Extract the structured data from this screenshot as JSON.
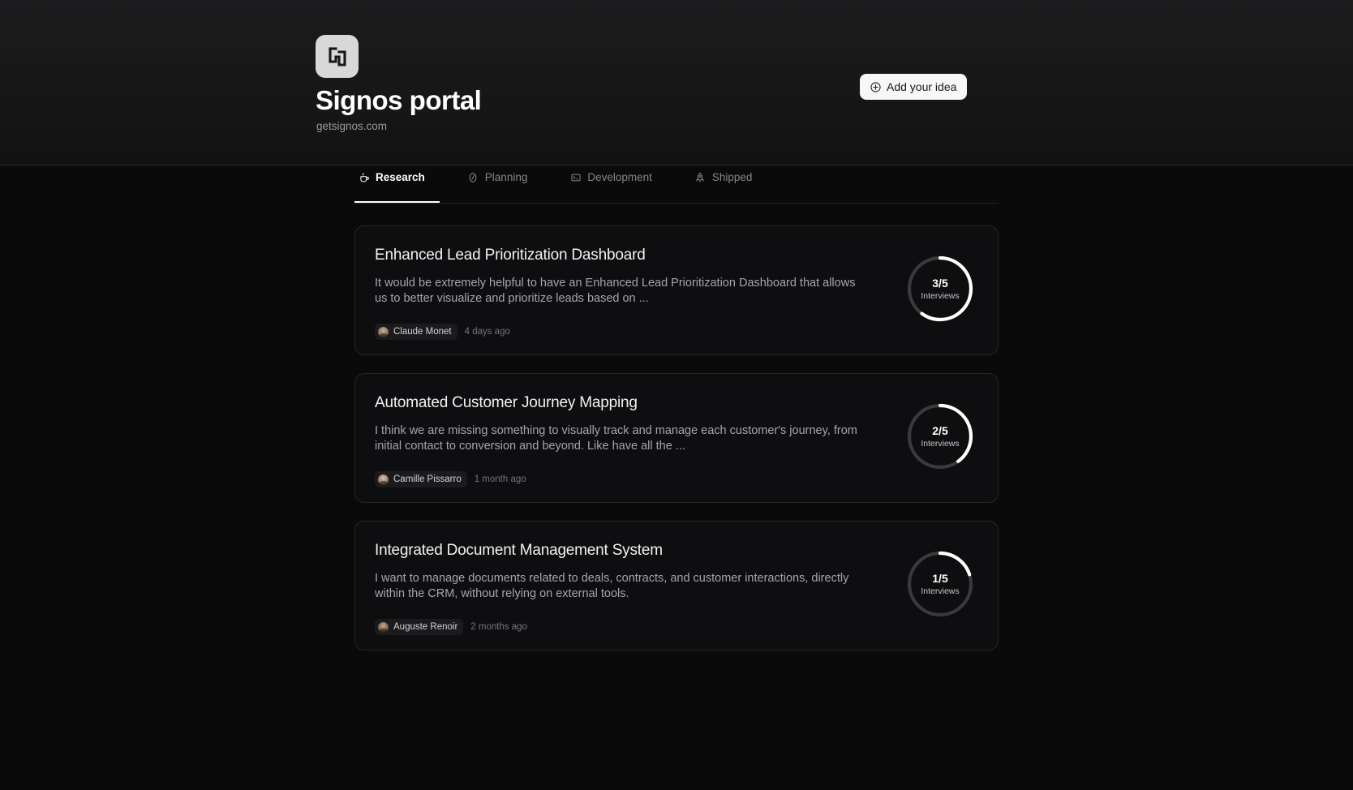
{
  "header": {
    "logo_icon": "signos-interlock-logo",
    "logo_bg": "#d8d8d8",
    "title": "Signos portal",
    "domain": "getsignos.com",
    "add_button": {
      "label": "Add your idea",
      "icon": "plus-circle-icon",
      "bg": "#f7f7f7",
      "text_color": "#18181a"
    }
  },
  "tabs": {
    "active_index": 0,
    "items": [
      {
        "label": "Research",
        "icon": "coffee-cup-icon",
        "active": true
      },
      {
        "label": "Planning",
        "icon": "compass-icon",
        "active": false
      },
      {
        "label": "Development",
        "icon": "terminal-icon",
        "active": false
      },
      {
        "label": "Shipped",
        "icon": "rocket-icon",
        "active": false
      }
    ]
  },
  "cards": [
    {
      "title": "Enhanced Lead Prioritization Dashboard",
      "description": "It would be extremely helpful to have an Enhanced Lead Prioritization Dashboard that allows us to better visualize and prioritize leads based  on ...",
      "author": "Claude Monet",
      "timestamp": "4 days ago",
      "progress_value": "3/5",
      "progress_caption": "Interviews",
      "progress_current": 3,
      "progress_total": 5
    },
    {
      "title": "Automated Customer Journey Mapping",
      "description": "I think we are missing something to visually track and manage  each customer's journey, from initial contact to conversion and beyond.  Like have all the ...",
      "author": "Camille Pissarro",
      "timestamp": "1 month ago",
      "progress_value": "2/5",
      "progress_caption": "Interviews",
      "progress_current": 2,
      "progress_total": 5
    },
    {
      "title": "Integrated Document Management System",
      "description": "I want to manage documents related to deals, contracts, and  customer interactions, directly within the CRM, without relying on  external tools.",
      "author": "Auguste Renoir",
      "timestamp": "2 months ago",
      "progress_value": "1/5",
      "progress_caption": "Interviews",
      "progress_current": 1,
      "progress_total": 5
    }
  ],
  "colors": {
    "page_bg": "#0a0a0b",
    "card_bg": "#0e0e10",
    "card_border": "#262629",
    "ring_progress": "#ffffff",
    "ring_track": "#3a3a3c",
    "muted_text": "#9a9a9d"
  }
}
